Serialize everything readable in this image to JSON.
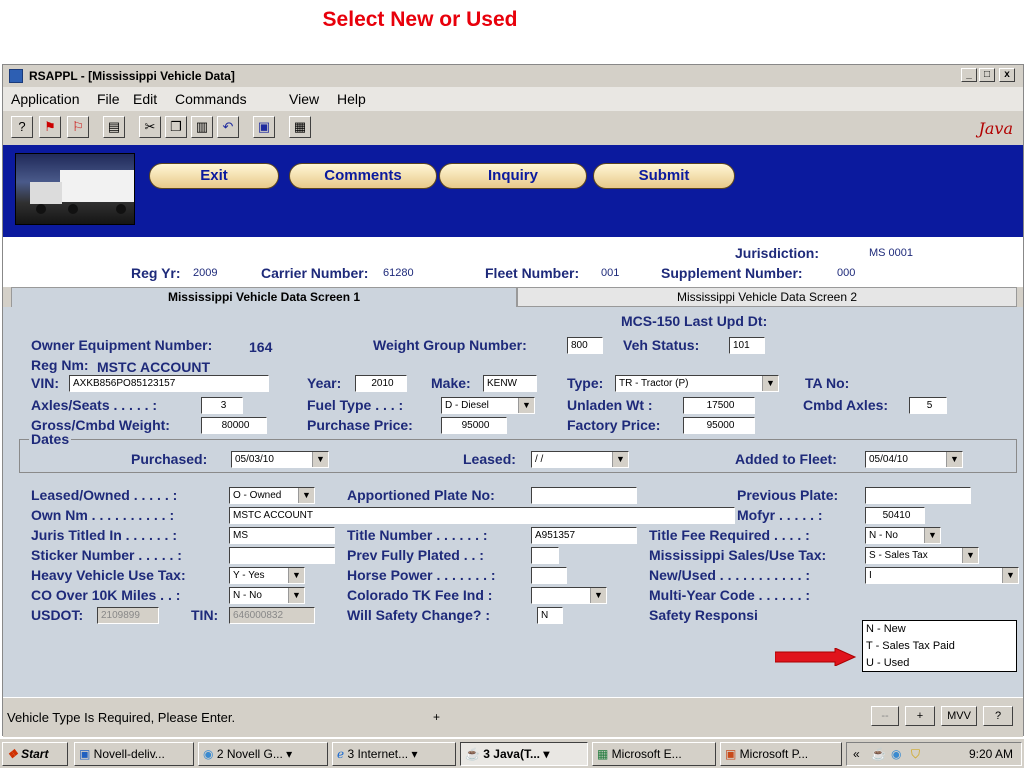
{
  "slide_title": "Select New or Used",
  "window": {
    "title": "RSAPPL - [Mississippi Vehicle Data]",
    "min_btn": "_",
    "max_btn": "□",
    "close_btn": "x"
  },
  "menu": [
    "Application",
    "File",
    "Edit",
    "Commands",
    "View",
    "Help"
  ],
  "toolbar": {
    "java_logo": "Java"
  },
  "banner_buttons": [
    "Exit",
    "Comments",
    "Inquiry",
    "Submit"
  ],
  "info": {
    "jurisdiction_label": "Jurisdiction:",
    "jurisdiction_value": "MS 0001",
    "reg_yr_label": "Reg Yr:",
    "reg_yr_value": "2009",
    "carrier_label": "Carrier Number:",
    "carrier_value": "61280",
    "fleet_label": "Fleet Number:",
    "fleet_value": "001",
    "supplement_label": "Supplement Number:",
    "supplement_value": "000"
  },
  "tabs": [
    "Mississippi Vehicle Data Screen 1",
    "Mississippi Vehicle Data Screen 2"
  ],
  "form": {
    "mcs150": "MCS-150 Last Upd Dt:",
    "owner_eq_label": "Owner Equipment Number:",
    "owner_eq_value": "164",
    "weight_group_label": "Weight Group Number:",
    "weight_group_value": "800",
    "veh_status_label": "Veh Status:",
    "veh_status_value": "101",
    "reg_nm_label": "Reg Nm:",
    "reg_nm_value": "MSTC ACCOUNT",
    "vin_label": "VIN:",
    "vin_value": "AXKB856PO85123157",
    "year_label": "Year:",
    "year_value": "2010",
    "make_label": "Make:",
    "make_value": "KENW",
    "type_label": "Type:",
    "type_value": "TR - Tractor (P)",
    "ta_no_label": "TA No:",
    "axles_label": "Axles/Seats . . . . . :",
    "axles_value": "3",
    "fuel_label": "Fuel Type . . . :",
    "fuel_value": "D - Diesel",
    "unladen_label": "Unladen Wt :",
    "unladen_value": "17500",
    "cmbd_axles_label": "Cmbd Axles:",
    "cmbd_axles_value": "5",
    "gross_label": "Gross/Cmbd Weight:",
    "gross_value": "80000",
    "purchase_label": "Purchase Price:",
    "purchase_value": "95000",
    "factory_label": "Factory Price:",
    "factory_value": "95000",
    "dates_legend": "Dates",
    "purchased_label": "Purchased:",
    "purchased_value": "05/03/10",
    "leased_label": "Leased:",
    "leased_value": "/ /",
    "added_label": "Added to Fleet:",
    "added_value": "05/04/10",
    "leased_owned_label": "Leased/Owned . . . . . :",
    "leased_owned_value": "O - Owned",
    "apportioned_label": "Apportioned Plate No:",
    "apportioned_value": "",
    "prev_plate_label": "Previous Plate:",
    "prev_plate_value": "",
    "own_nm_label": "Own Nm . . . . . . . . . . :",
    "own_nm_value": "MSTC ACCOUNT",
    "mofyr_label": "Mofyr . . . . . :",
    "mofyr_value": "50410",
    "juris_titled_label": "Juris Titled In . . . . . . :",
    "juris_titled_value": "MS",
    "title_number_label": "Title Number . . . . . . :",
    "title_number_value": "A951357",
    "title_fee_label": "Title Fee Required . . . . :",
    "title_fee_value": "N - No",
    "sticker_label": "Sticker Number . . . . . :",
    "sticker_value": "",
    "prev_fully_label": "Prev Fully Plated . . :",
    "prev_fully_value": "",
    "ms_sales_label": "Mississippi Sales/Use Tax:",
    "ms_sales_value": "S - Sales Tax",
    "heavy_label": "Heavy Vehicle Use Tax:",
    "heavy_value": "Y - Yes",
    "horse_label": "Horse Power . . . . . . . :",
    "horse_value": "",
    "new_used_label": "New/Used . . . . . . . . . . . :",
    "new_used_value": "I",
    "co_label": "CO Over 10K Miles . . :",
    "co_value": "N - No",
    "colorado_label": "Colorado TK Fee Ind :",
    "colorado_value": "",
    "multi_label": "Multi-Year Code . . . . . . :",
    "usdot_label": "USDOT:",
    "usdot_value": "2109899",
    "tin_label": "TIN:",
    "tin_value": "646000832",
    "will_safety_label": "Will Safety Change? :",
    "will_safety_value": "N",
    "safety_resp_label": "Safety Responsi"
  },
  "dropdown_options": [
    "N - New",
    "T - Sales Tax Paid",
    "U - Used"
  ],
  "status": {
    "message": "Vehicle Type Is Required, Please Enter.",
    "plus": "+",
    "btn_dash": "--",
    "btn_plus": "+",
    "btn_mvv": "MVV",
    "btn_help": "?"
  },
  "taskbar": {
    "start": "Start",
    "tasks": [
      "Novell-deliv...",
      "2 Novell G...",
      "3 Internet...",
      "3 Java(T...",
      "Microsoft E...",
      "Microsoft P..."
    ],
    "tray_chevron": "«",
    "clock": "9:20 AM"
  },
  "colors": {
    "banner": "#0b1a9e",
    "label": "#1e2a7a",
    "form_bg": "#ccd4dd",
    "title": "#e8000b"
  }
}
